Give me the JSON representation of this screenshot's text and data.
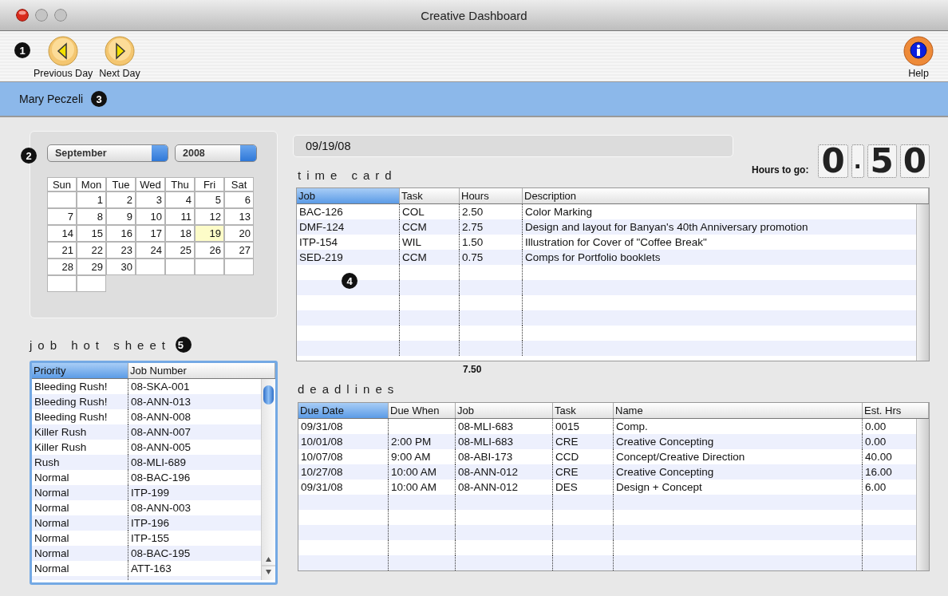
{
  "window": {
    "title": "Creative Dashboard"
  },
  "toolbar": {
    "callout": "1",
    "buttons": [
      {
        "kind": "previous",
        "label": "Previous Day"
      },
      {
        "kind": "next",
        "label": "Next Day"
      },
      {
        "kind": "help",
        "label": "Help"
      }
    ]
  },
  "user_bar": {
    "name": "Mary Peczeli",
    "callout": "3"
  },
  "calendar": {
    "callout": "2",
    "month": "September",
    "year": "2008",
    "weekdays": [
      "Sun",
      "Mon",
      "Tue",
      "Wed",
      "Thu",
      "Fri",
      "Sat"
    ],
    "weeks": [
      [
        {
          "kind": "blank"
        },
        {
          "kind": "day",
          "day": "1",
          "selected": false
        },
        {
          "kind": "day",
          "day": "2",
          "selected": false
        },
        {
          "kind": "day",
          "day": "3",
          "selected": false
        },
        {
          "kind": "day",
          "day": "4",
          "selected": false
        },
        {
          "kind": "day",
          "day": "5",
          "selected": false
        },
        {
          "kind": "day",
          "day": "6",
          "selected": false
        }
      ],
      [
        {
          "kind": "day",
          "day": "7",
          "selected": false
        },
        {
          "kind": "day",
          "day": "8",
          "selected": false
        },
        {
          "kind": "day",
          "day": "9",
          "selected": false
        },
        {
          "kind": "day",
          "day": "10",
          "selected": false
        },
        {
          "kind": "day",
          "day": "11",
          "selected": false
        },
        {
          "kind": "day",
          "day": "12",
          "selected": false
        },
        {
          "kind": "day",
          "day": "13",
          "selected": false
        }
      ],
      [
        {
          "kind": "day",
          "day": "14",
          "selected": false
        },
        {
          "kind": "day",
          "day": "15",
          "selected": false
        },
        {
          "kind": "day",
          "day": "16",
          "selected": false
        },
        {
          "kind": "day",
          "day": "17",
          "selected": false
        },
        {
          "kind": "day",
          "day": "18",
          "selected": false
        },
        {
          "kind": "day",
          "day": "19",
          "selected": true
        },
        {
          "kind": "day",
          "day": "20",
          "selected": false
        }
      ],
      [
        {
          "kind": "day",
          "day": "21",
          "selected": false
        },
        {
          "kind": "day",
          "day": "22",
          "selected": false
        },
        {
          "kind": "day",
          "day": "23",
          "selected": false
        },
        {
          "kind": "day",
          "day": "24",
          "selected": false
        },
        {
          "kind": "day",
          "day": "25",
          "selected": false
        },
        {
          "kind": "day",
          "day": "26",
          "selected": false
        },
        {
          "kind": "day",
          "day": "27",
          "selected": false
        }
      ],
      [
        {
          "kind": "day",
          "day": "28",
          "selected": false
        },
        {
          "kind": "day",
          "day": "29",
          "selected": false
        },
        {
          "kind": "day",
          "day": "30",
          "selected": false
        },
        {
          "kind": "blank"
        },
        {
          "kind": "blank"
        },
        {
          "kind": "blank"
        },
        {
          "kind": "blank"
        }
      ],
      [
        {
          "kind": "blank"
        },
        {
          "kind": "blank"
        }
      ]
    ]
  },
  "job_hot_sheet": {
    "title": "job hot sheet",
    "callout": "5",
    "columns": [
      {
        "label": "Priority",
        "selected": true
      },
      {
        "label": "Job Number",
        "selected": false
      }
    ],
    "rows": [
      [
        "Bleeding Rush!",
        "08-SKA-001"
      ],
      [
        "Bleeding Rush!",
        "08-ANN-013"
      ],
      [
        "Bleeding Rush!",
        "08-ANN-008"
      ],
      [
        "Killer Rush",
        "08-ANN-007"
      ],
      [
        "Killer Rush",
        "08-ANN-005"
      ],
      [
        "Rush",
        "08-MLI-689"
      ],
      [
        "Normal",
        "08-BAC-196"
      ],
      [
        "Normal",
        "ITP-199"
      ],
      [
        "Normal",
        "08-ANN-003"
      ],
      [
        "Normal",
        "ITP-196"
      ],
      [
        "Normal",
        "ITP-155"
      ],
      [
        "Normal",
        "08-BAC-195"
      ],
      [
        "Normal",
        "ATT-163"
      ]
    ]
  },
  "date": "09/19/08",
  "hours_to_go": {
    "label": "Hours to go:",
    "value": "0.50"
  },
  "time_card": {
    "title": "time card",
    "callout": "4",
    "columns": [
      {
        "label": "Job",
        "selected": true
      },
      {
        "label": "Task",
        "selected": false
      },
      {
        "label": "Hours",
        "selected": false
      },
      {
        "label": "Description",
        "selected": false
      }
    ],
    "rows": [
      [
        "BAC-126",
        "COL",
        "2.50",
        "Color Marking"
      ],
      [
        "DMF-124",
        "CCM",
        "2.75",
        "Design and layout for Banyan's 40th Anniversary promotion"
      ],
      [
        "ITP-154",
        "WIL",
        "1.50",
        "Illustration for Cover of \"Coffee Break\""
      ],
      [
        "SED-219",
        "CCM",
        "0.75",
        "Comps for Portfolio booklets"
      ]
    ],
    "total_hours": "7.50"
  },
  "deadlines": {
    "title": "deadlines",
    "columns": [
      {
        "label": "Due Date",
        "selected": true
      },
      {
        "label": "Due When",
        "selected": false
      },
      {
        "label": "Job",
        "selected": false
      },
      {
        "label": "Task",
        "selected": false
      },
      {
        "label": "Name",
        "selected": false
      },
      {
        "label": "Est. Hrs",
        "selected": false
      }
    ],
    "rows": [
      [
        "09/31/08",
        null,
        "08-MLI-683",
        "0015",
        "Comp.",
        "0.00"
      ],
      [
        "10/01/08",
        "2:00 PM",
        "08-MLI-683",
        "CRE",
        "Creative Concepting",
        "0.00"
      ],
      [
        "10/07/08",
        "9:00 AM",
        "08-ABI-173",
        "CCD",
        "Concept/Creative Direction",
        "40.00"
      ],
      [
        "10/27/08",
        "10:00 AM",
        "08-ANN-012",
        "CRE",
        "Creative Concepting",
        "16.00"
      ],
      [
        "09/31/08",
        "10:00 AM",
        "08-ANN-012",
        "DES",
        "Design + Concept",
        "6.00"
      ]
    ]
  }
}
